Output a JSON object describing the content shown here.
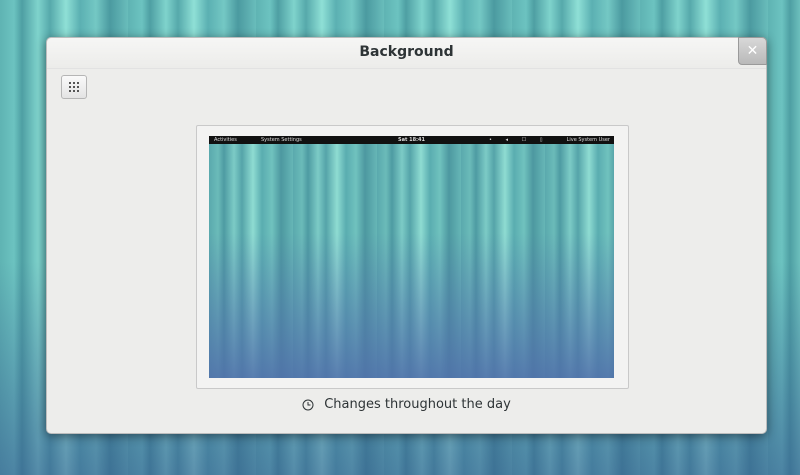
{
  "window": {
    "title": "Background",
    "close_glyph": "✕"
  },
  "toolbar": {
    "view_button_icon": "grid-icon"
  },
  "preview": {
    "topbar": {
      "activities": "Activities",
      "app_menu": "System Settings",
      "clock": "Sat 18:41",
      "indicators": "• ◂ ☐ ▯",
      "user": "Live System User"
    }
  },
  "caption": {
    "icon": "clock-icon",
    "text": "Changes throughout the day"
  },
  "colors": {
    "dialog_bg": "#ededeb",
    "topbar_bg": "#111111",
    "teal_accent": "#6cc3c0"
  }
}
